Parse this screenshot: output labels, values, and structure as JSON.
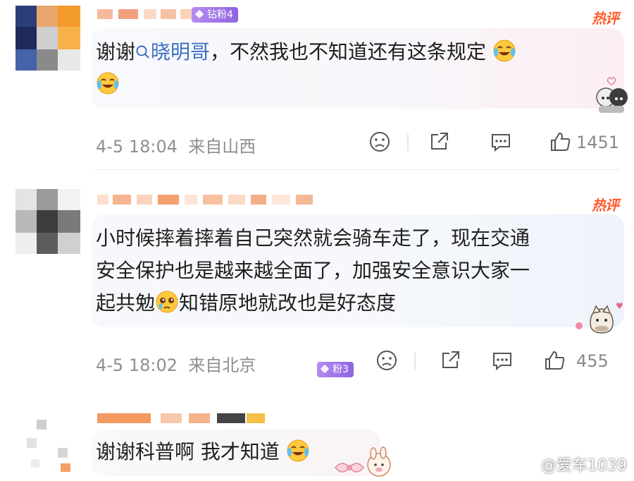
{
  "colors": {
    "hot_tag": "#ff5a2b",
    "mention": "#3a6fc4",
    "fan_badge": "#9f74e8",
    "meta_text": "#8f8f8f"
  },
  "comments": [
    {
      "fan_badge": "钻粉4",
      "hot_tag": "热评",
      "text_before": "谢谢",
      "mention": "晓明哥",
      "text_after": "，不然我也不知道还有这条规定",
      "emoji_names": [
        "crying-laughing-emoji",
        "crying-laughing-emoji"
      ],
      "time": "4-5 18:04",
      "location": "来自山西",
      "like_count": "1451",
      "icons": [
        "dislike-icon",
        "share-icon",
        "comment-icon",
        "like-icon"
      ]
    },
    {
      "fan_badge": "粉3",
      "hot_tag": "热评",
      "line1": "小时候摔着摔着自己突然就会骑车走了，现在交通",
      "line2": "安全保护也是越来越全面了，加强安全意识大家一",
      "line3_before": "起共勉",
      "line3_after": "知错原地就改也是好态度",
      "emoji_names": [
        "pleading-tears-emoji"
      ],
      "time": "4-5 18:02",
      "location": "来自北京",
      "like_count": "455",
      "icons": [
        "dislike-icon",
        "share-icon",
        "comment-icon",
        "like-icon"
      ]
    },
    {
      "text": "谢谢科普啊 我才知道",
      "emoji_names": [
        "crying-laughing-emoji"
      ]
    }
  ],
  "watermark": "@爱车1039"
}
